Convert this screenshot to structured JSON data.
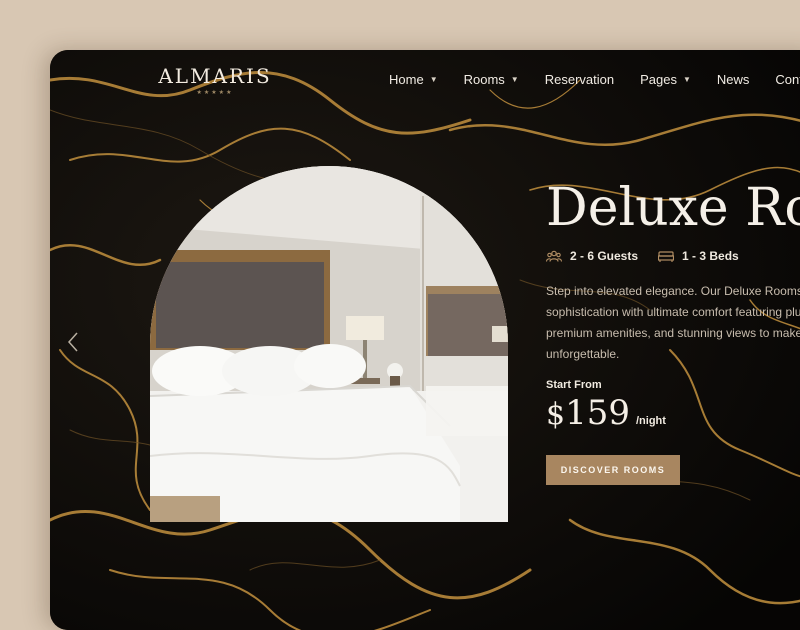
{
  "brand": {
    "name": "ALMARIS",
    "stars": "★★★★★"
  },
  "nav": {
    "items": [
      {
        "label": "Home",
        "has_dropdown": true
      },
      {
        "label": "Rooms",
        "has_dropdown": true
      },
      {
        "label": "Reservation",
        "has_dropdown": false
      },
      {
        "label": "Pages",
        "has_dropdown": true
      },
      {
        "label": "News",
        "has_dropdown": false
      },
      {
        "label": "Contact",
        "has_dropdown": false
      }
    ]
  },
  "hero": {
    "title": "Deluxe Rooms",
    "guests": "2 - 6 Guests",
    "beds": "1 - 3 Beds",
    "description": "Step into elevated elegance. Our Deluxe Rooms blend\nsophistication with ultimate comfort featuring plush bedding,\npremium amenities, and stunning views to make your stay\nunforgettable.",
    "price_label": "Start From",
    "currency": "$",
    "price": "159",
    "price_unit": "/night",
    "cta_label": "DISCOVER ROOMS"
  },
  "icons": {
    "guests": "users-icon",
    "beds": "bed-icon",
    "prev": "chevron-left-icon",
    "dropdown": "chevron-down-icon"
  },
  "colors": {
    "page_bg": "#d8c7b3",
    "marble_dark": "#0b0906",
    "gold_vein": "#b98a3e",
    "accent": "#a88660",
    "text_light": "#f5f0e8"
  }
}
